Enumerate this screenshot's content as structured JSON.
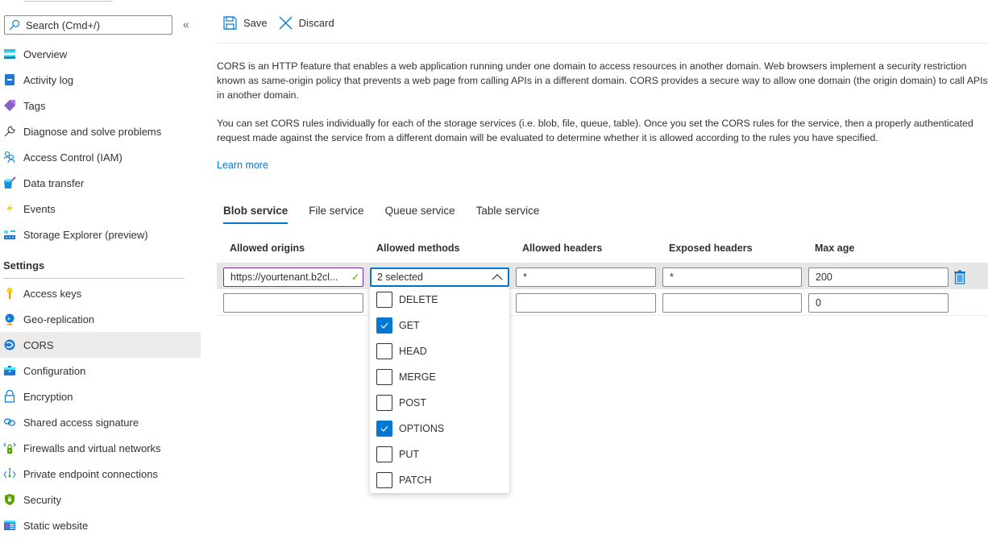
{
  "sidebar": {
    "search_placeholder": "Search (Cmd+/)",
    "collapse_label": "«",
    "items": [
      {
        "label": "Overview",
        "icon": "overview-icon"
      },
      {
        "label": "Activity log",
        "icon": "activity-log-icon"
      },
      {
        "label": "Tags",
        "icon": "tag-icon"
      },
      {
        "label": "Diagnose and solve problems",
        "icon": "wrench-icon"
      },
      {
        "label": "Access Control (IAM)",
        "icon": "people-icon"
      },
      {
        "label": "Data transfer",
        "icon": "data-transfer-icon"
      },
      {
        "label": "Events",
        "icon": "lightning-icon"
      },
      {
        "label": "Storage Explorer (preview)",
        "icon": "storage-explorer-icon"
      }
    ],
    "settings_header": "Settings",
    "settings_items": [
      {
        "label": "Access keys",
        "icon": "key-icon"
      },
      {
        "label": "Geo-replication",
        "icon": "globe-icon"
      },
      {
        "label": "CORS",
        "icon": "cors-icon",
        "active": true
      },
      {
        "label": "Configuration",
        "icon": "briefcase-icon"
      },
      {
        "label": "Encryption",
        "icon": "lock-icon"
      },
      {
        "label": "Shared access signature",
        "icon": "link-icon"
      },
      {
        "label": "Firewalls and virtual networks",
        "icon": "firewall-icon"
      },
      {
        "label": "Private endpoint connections",
        "icon": "private-endpoint-icon"
      },
      {
        "label": "Security",
        "icon": "shield-icon"
      },
      {
        "label": "Static website",
        "icon": "static-website-icon"
      }
    ]
  },
  "toolbar": {
    "save_label": "Save",
    "discard_label": "Discard"
  },
  "main": {
    "description_1": "CORS is an HTTP feature that enables a web application running under one domain to access resources in another domain. Web browsers implement a security restriction known as same-origin policy that prevents a web page from calling APIs in a different domain. CORS provides a secure way to allow one domain (the origin domain) to call APIs in another domain.",
    "description_2": "You can set CORS rules individually for each of the storage services (i.e. blob, file, queue, table). Once you set the CORS rules for the service, then a properly authenticated request made against the service from a different domain will be evaluated to determine whether it is allowed according to the rules you have specified.",
    "learn_more": "Learn more",
    "tabs": [
      {
        "label": "Blob service",
        "active": true
      },
      {
        "label": "File service"
      },
      {
        "label": "Queue service"
      },
      {
        "label": "Table service"
      }
    ],
    "columns": [
      "Allowed origins",
      "Allowed methods",
      "Allowed headers",
      "Exposed headers",
      "Max age"
    ],
    "rows": [
      {
        "allowed_origins": "https://yourtenant.b2cl...",
        "allowed_methods": "2 selected",
        "allowed_headers": "*",
        "exposed_headers": "*",
        "max_age": "200"
      },
      {
        "allowed_origins": "",
        "allowed_methods": "",
        "allowed_headers": "",
        "exposed_headers": "",
        "max_age": "0"
      }
    ],
    "methods_options": [
      {
        "label": "DELETE",
        "checked": false
      },
      {
        "label": "GET",
        "checked": true
      },
      {
        "label": "HEAD",
        "checked": false
      },
      {
        "label": "MERGE",
        "checked": false
      },
      {
        "label": "POST",
        "checked": false
      },
      {
        "label": "OPTIONS",
        "checked": true
      },
      {
        "label": "PUT",
        "checked": false
      },
      {
        "label": "PATCH",
        "checked": false
      }
    ]
  },
  "colors": {
    "accent": "#0078d4",
    "valid_border": "#8a2da5",
    "valid_check": "#57a300",
    "selected_row": "#e6e6e6"
  }
}
